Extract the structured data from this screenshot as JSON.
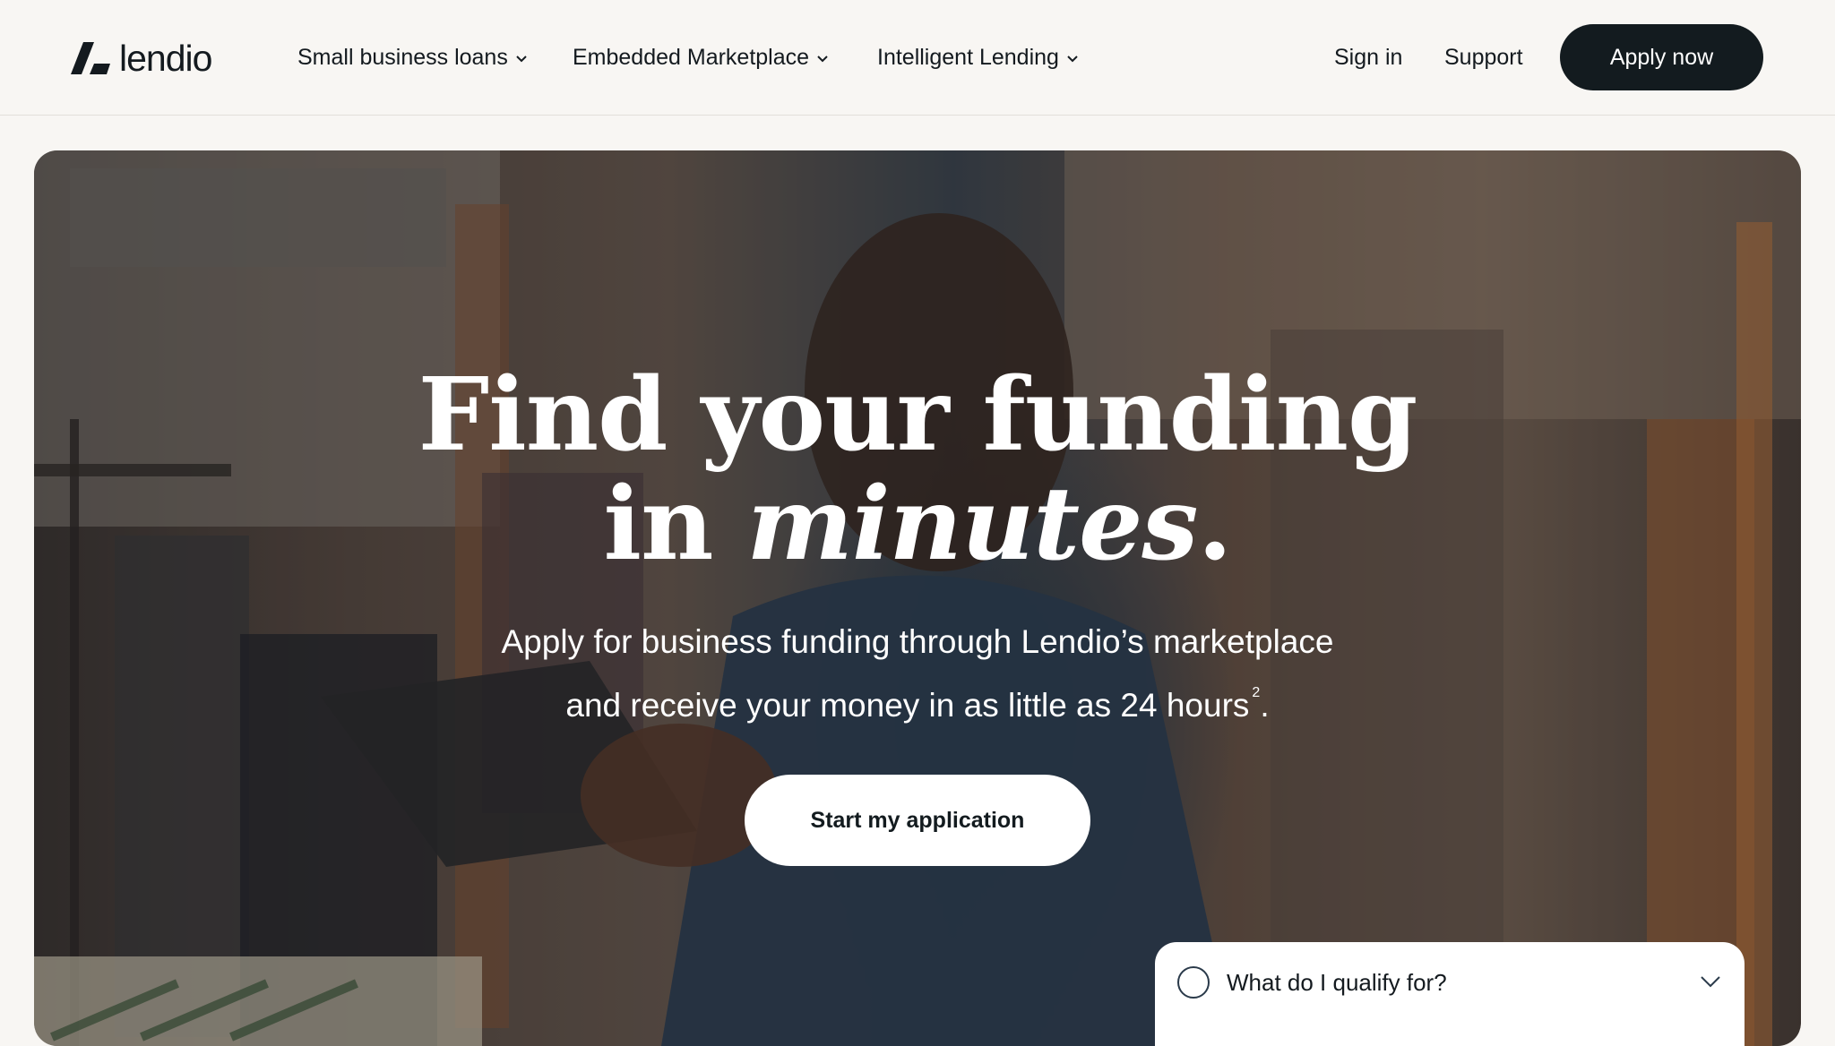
{
  "header": {
    "logo_text": "lendio",
    "nav": [
      {
        "label": "Small business loans"
      },
      {
        "label": "Embedded Marketplace"
      },
      {
        "label": "Intelligent Lending"
      }
    ],
    "sign_in": "Sign in",
    "support": "Support",
    "apply_now": "Apply now"
  },
  "hero": {
    "headline_line1": "Find your funding",
    "headline_line2_prefix": "in ",
    "headline_line2_emphasis": "minutes",
    "headline_line2_suffix": ".",
    "subhead_line1": "Apply for business funding through Lendio’s marketplace",
    "subhead_line2": "and receive your money in as little as 24 hours",
    "subhead_footnote": "2",
    "subhead_end": ".",
    "cta": "Start my application",
    "qualify_label": "What do I qualify for?"
  },
  "colors": {
    "background": "#f8f6f3",
    "primary_button": "#131b1f",
    "text_dark": "#141a1f",
    "text_light": "#ffffff"
  }
}
